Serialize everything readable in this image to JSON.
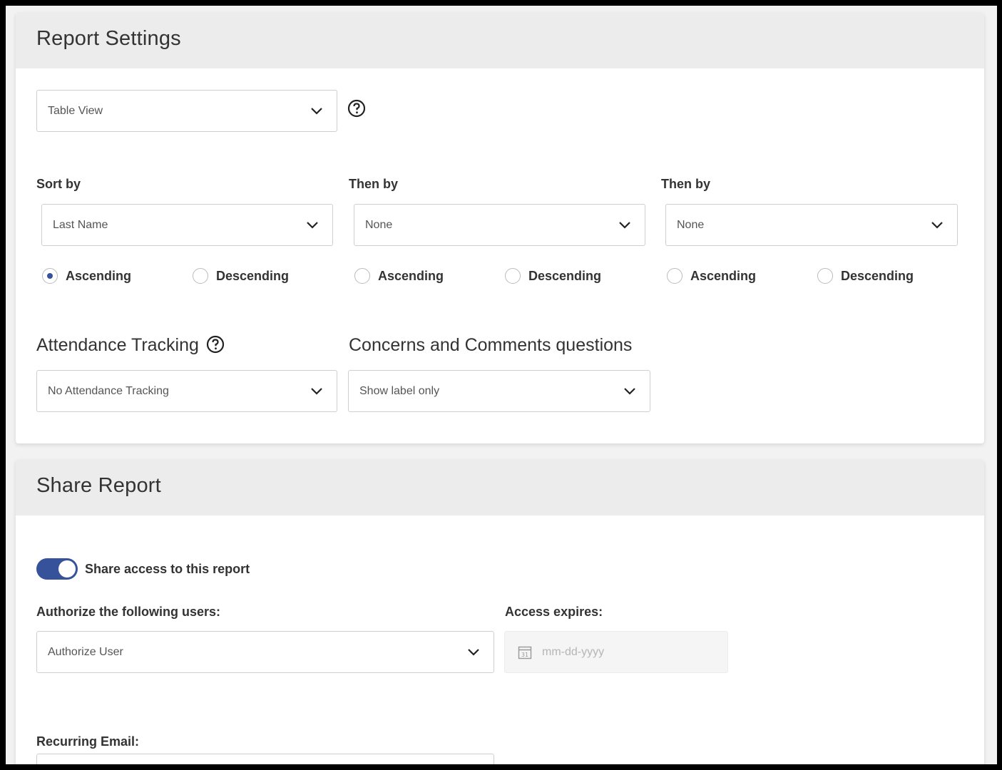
{
  "report_settings": {
    "title": "Report Settings",
    "view_select": {
      "value": "Table View"
    },
    "sort": [
      {
        "label": "Sort by",
        "value": "Last Name",
        "ascending": "Ascending",
        "descending": "Descending",
        "selected": "ascending"
      },
      {
        "label": "Then by",
        "value": "None",
        "ascending": "Ascending",
        "descending": "Descending",
        "selected": "none"
      },
      {
        "label": "Then by",
        "value": "None",
        "ascending": "Ascending",
        "descending": "Descending",
        "selected": "none"
      }
    ],
    "attendance": {
      "heading": "Attendance Tracking",
      "value": "No Attendance Tracking"
    },
    "concerns": {
      "heading": "Concerns and Comments questions",
      "value": "Show label only"
    }
  },
  "share_report": {
    "title": "Share Report",
    "toggle": {
      "label": "Share access to this report",
      "on": true
    },
    "authorize": {
      "label": "Authorize the following users:",
      "value": "Authorize User"
    },
    "expires": {
      "label": "Access expires:",
      "placeholder": "mm-dd-yyyy",
      "calendar_day": "31"
    },
    "recurring": {
      "label": "Recurring Email:"
    }
  },
  "colors": {
    "accent": "#35529a",
    "header_bg": "#ececec"
  },
  "icons": {
    "help": "question-circle-icon",
    "chevron": "chevron-down-icon",
    "calendar": "calendar-icon"
  }
}
